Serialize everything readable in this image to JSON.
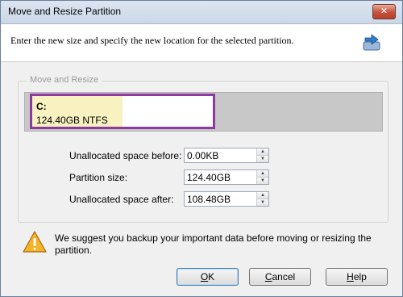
{
  "window": {
    "title": "Move and Resize Partition",
    "close_symbol": "✕"
  },
  "header": {
    "description": "Enter the new size and specify the new location for the selected partition.",
    "icon": "move-arrows-icon"
  },
  "group": {
    "legend": "Move and Resize",
    "partition": {
      "drive": "C:",
      "info": "124.40GB NTFS",
      "used_fraction": 0.5
    }
  },
  "fields": [
    {
      "label": "Unallocated space before:",
      "value": "0.00KB"
    },
    {
      "label": "Partition size:",
      "value": "124.40GB"
    },
    {
      "label": "Unallocated space after:",
      "value": "108.48GB"
    }
  ],
  "warning": {
    "icon": "warning-triangle-icon",
    "text": "We suggest you backup your important data before moving or resizing the partition."
  },
  "buttons": {
    "ok_first": "O",
    "ok_rest": "K",
    "cancel_first": "C",
    "cancel_rest": "ancel",
    "help_first": "H",
    "help_rest": "elp"
  },
  "colors": {
    "partition_border": "#8c3aa0",
    "used_fill": "#f7f2bf",
    "unallocated": "#c8c8c8"
  }
}
